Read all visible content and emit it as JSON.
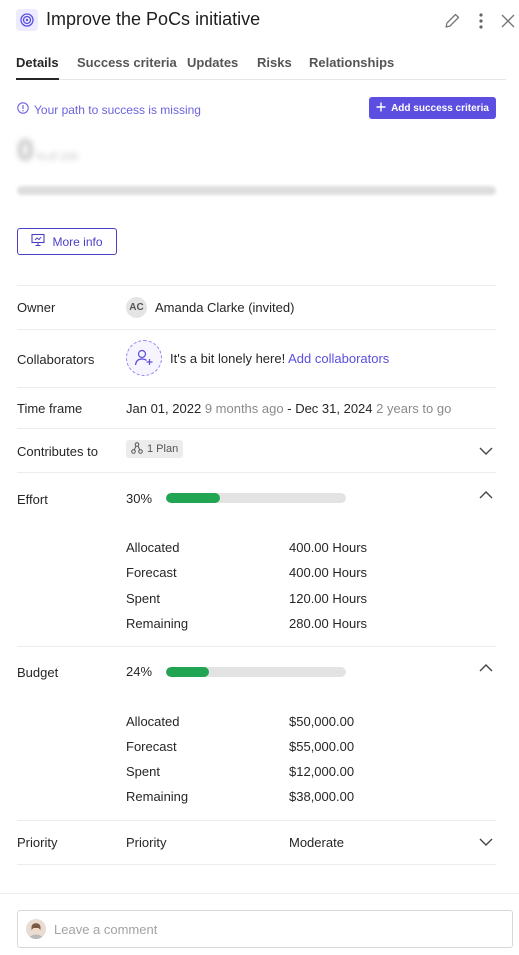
{
  "header": {
    "title": "Improve the PoCs initiative",
    "icon": "goal-target-icon",
    "actions": [
      "edit-icon",
      "more-vertical-icon",
      "close-icon"
    ]
  },
  "tabs": [
    {
      "label": "Details",
      "active": true
    },
    {
      "label": "Success criteria"
    },
    {
      "label": "Updates"
    },
    {
      "label": "Risks"
    },
    {
      "label": "Relationships"
    }
  ],
  "success": {
    "warning": "Your path to success is missing",
    "add_button": "Add success criteria",
    "percent": "0",
    "percent_unit": "%",
    "of_label": "of 100"
  },
  "more_info_label": "More info",
  "owner": {
    "label": "Owner",
    "initials": "AC",
    "name": "Amanda Clarke (invited)"
  },
  "collaborators": {
    "label": "Collaborators",
    "empty_text": "It's a bit lonely here!",
    "add_link": "Add collaborators"
  },
  "timeframe": {
    "label": "Time frame",
    "start": "Jan 01, 2022",
    "start_rel": "9 months ago",
    "sep": "-",
    "end": "Dec 31, 2024",
    "end_rel": "2 years to go"
  },
  "contributes": {
    "label": "Contributes to",
    "chip": "1 Plan"
  },
  "effort": {
    "label": "Effort",
    "percent_label": "30%",
    "progress": 0.3,
    "rows": [
      {
        "label": "Allocated",
        "value": "400.00 Hours"
      },
      {
        "label": "Forecast",
        "value": "400.00 Hours"
      },
      {
        "label": "Spent",
        "value": "120.00 Hours"
      },
      {
        "label": "Remaining",
        "value": "280.00 Hours"
      }
    ]
  },
  "budget": {
    "label": "Budget",
    "percent_label": "24%",
    "progress": 0.24,
    "rows": [
      {
        "label": "Allocated",
        "value": "$50,000.00"
      },
      {
        "label": "Forecast",
        "value": "$55,000.00"
      },
      {
        "label": "Spent",
        "value": "$12,000.00"
      },
      {
        "label": "Remaining",
        "value": "$38,000.00"
      }
    ]
  },
  "priority": {
    "label": "Priority",
    "field": "Priority",
    "value": "Moderate"
  },
  "comment": {
    "placeholder": "Leave a comment"
  },
  "colors": {
    "accent": "#5b4ee0",
    "progress": "#22a552"
  }
}
